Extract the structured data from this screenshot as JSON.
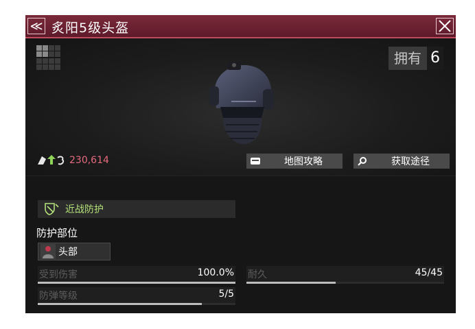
{
  "header": {
    "title": "炙阳5级头盔",
    "back_glyph": "≪"
  },
  "item": {
    "owned_label": "拥有",
    "owned_count": "6",
    "power_value": "230,614",
    "icon": "tactical-helmet-icon"
  },
  "actions": {
    "map_label": "地图攻略",
    "source_label": "获取途径"
  },
  "protection": {
    "type_label": "近战防护",
    "part_heading": "防护部位",
    "part_value": "头部"
  },
  "stats": [
    {
      "name": "受到伤害",
      "value": "100.0%",
      "fill": 1.0
    },
    {
      "name": "耐久",
      "value": "45/45",
      "fill": 0.45
    },
    {
      "name": "防弹等级",
      "value": "5/5",
      "fill": 0.83
    }
  ],
  "colors": {
    "title_bar": "#6b2232",
    "accent_green": "#b5e27a",
    "power_red": "#e66a7e"
  }
}
